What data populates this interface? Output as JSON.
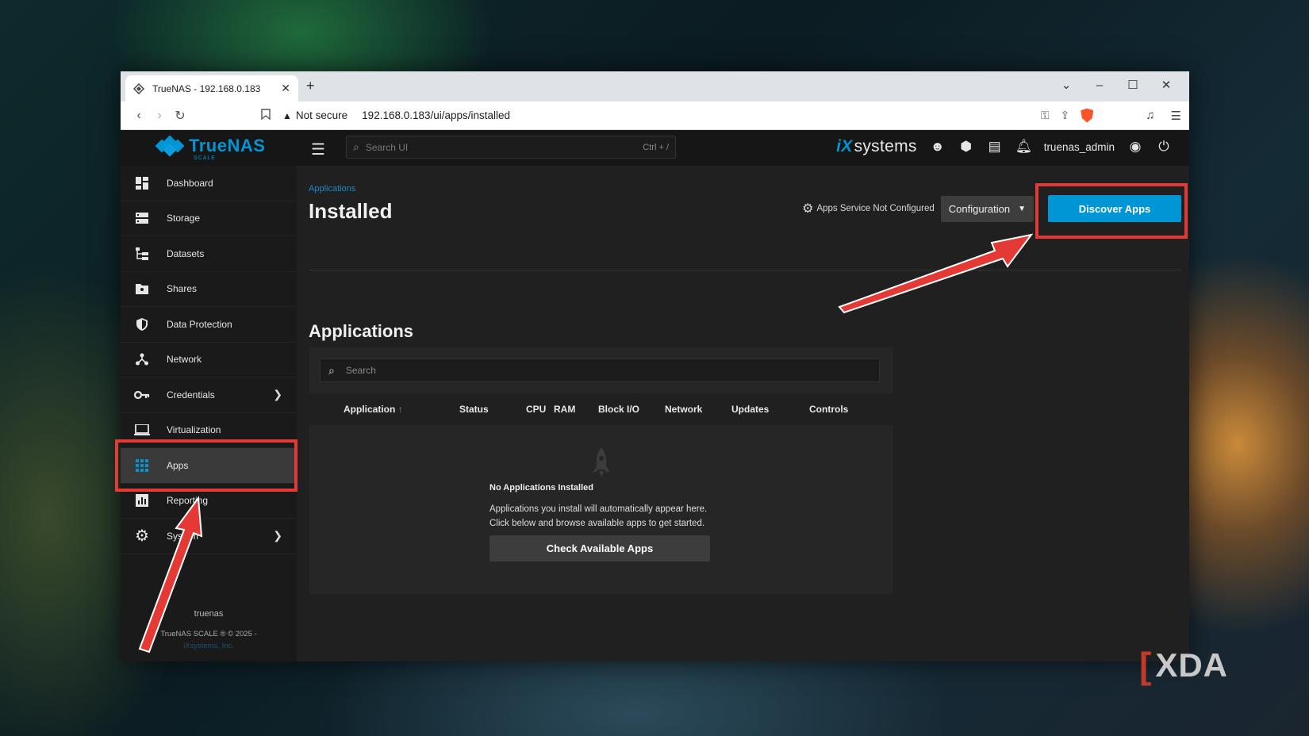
{
  "browser": {
    "tab_title": "TrueNAS - 192.168.0.183",
    "tab_close": "✕",
    "new_tab": "+",
    "win_controls": [
      "⌄",
      "–",
      "☐",
      "✕"
    ],
    "security_label": "Not secure",
    "url": "192.168.0.183/ui/apps/installed"
  },
  "header": {
    "logo_text": "TrueNAS",
    "logo_sub": "SCALE",
    "search_placeholder": "Search UI",
    "search_shortcut": "Ctrl + /",
    "vendor_brand": "iX",
    "vendor_text": "systems",
    "username": "truenas_admin"
  },
  "sidebar": {
    "items": [
      {
        "label": "Dashboard"
      },
      {
        "label": "Storage"
      },
      {
        "label": "Datasets"
      },
      {
        "label": "Shares"
      },
      {
        "label": "Data Protection"
      },
      {
        "label": "Network"
      },
      {
        "label": "Credentials"
      },
      {
        "label": "Virtualization"
      },
      {
        "label": "Apps"
      },
      {
        "label": "Reporting"
      },
      {
        "label": "System"
      }
    ],
    "hostname": "truenas",
    "copyright": "TrueNAS SCALE ® © 2025 -",
    "company": "iXsystems, Inc."
  },
  "main": {
    "breadcrumb": "Applications",
    "title": "Installed",
    "service_status": "Apps Service Not Configured",
    "configuration_label": "Configuration",
    "discover_label": "Discover Apps",
    "section_title": "Applications",
    "search_placeholder": "Search",
    "columns": [
      "Application",
      "Status",
      "CPU",
      "RAM",
      "Block I/O",
      "Network",
      "Updates",
      "Controls"
    ],
    "sort_indicator": "↑",
    "empty_title": "No Applications Installed",
    "empty_line1": "Applications you install will automatically appear here.",
    "empty_line2": "Click below and browse available apps to get started.",
    "check_button": "Check Available Apps"
  },
  "watermark": {
    "text": "XDA"
  },
  "colors": {
    "accent": "#0095d5",
    "annotation": "#e53935"
  }
}
